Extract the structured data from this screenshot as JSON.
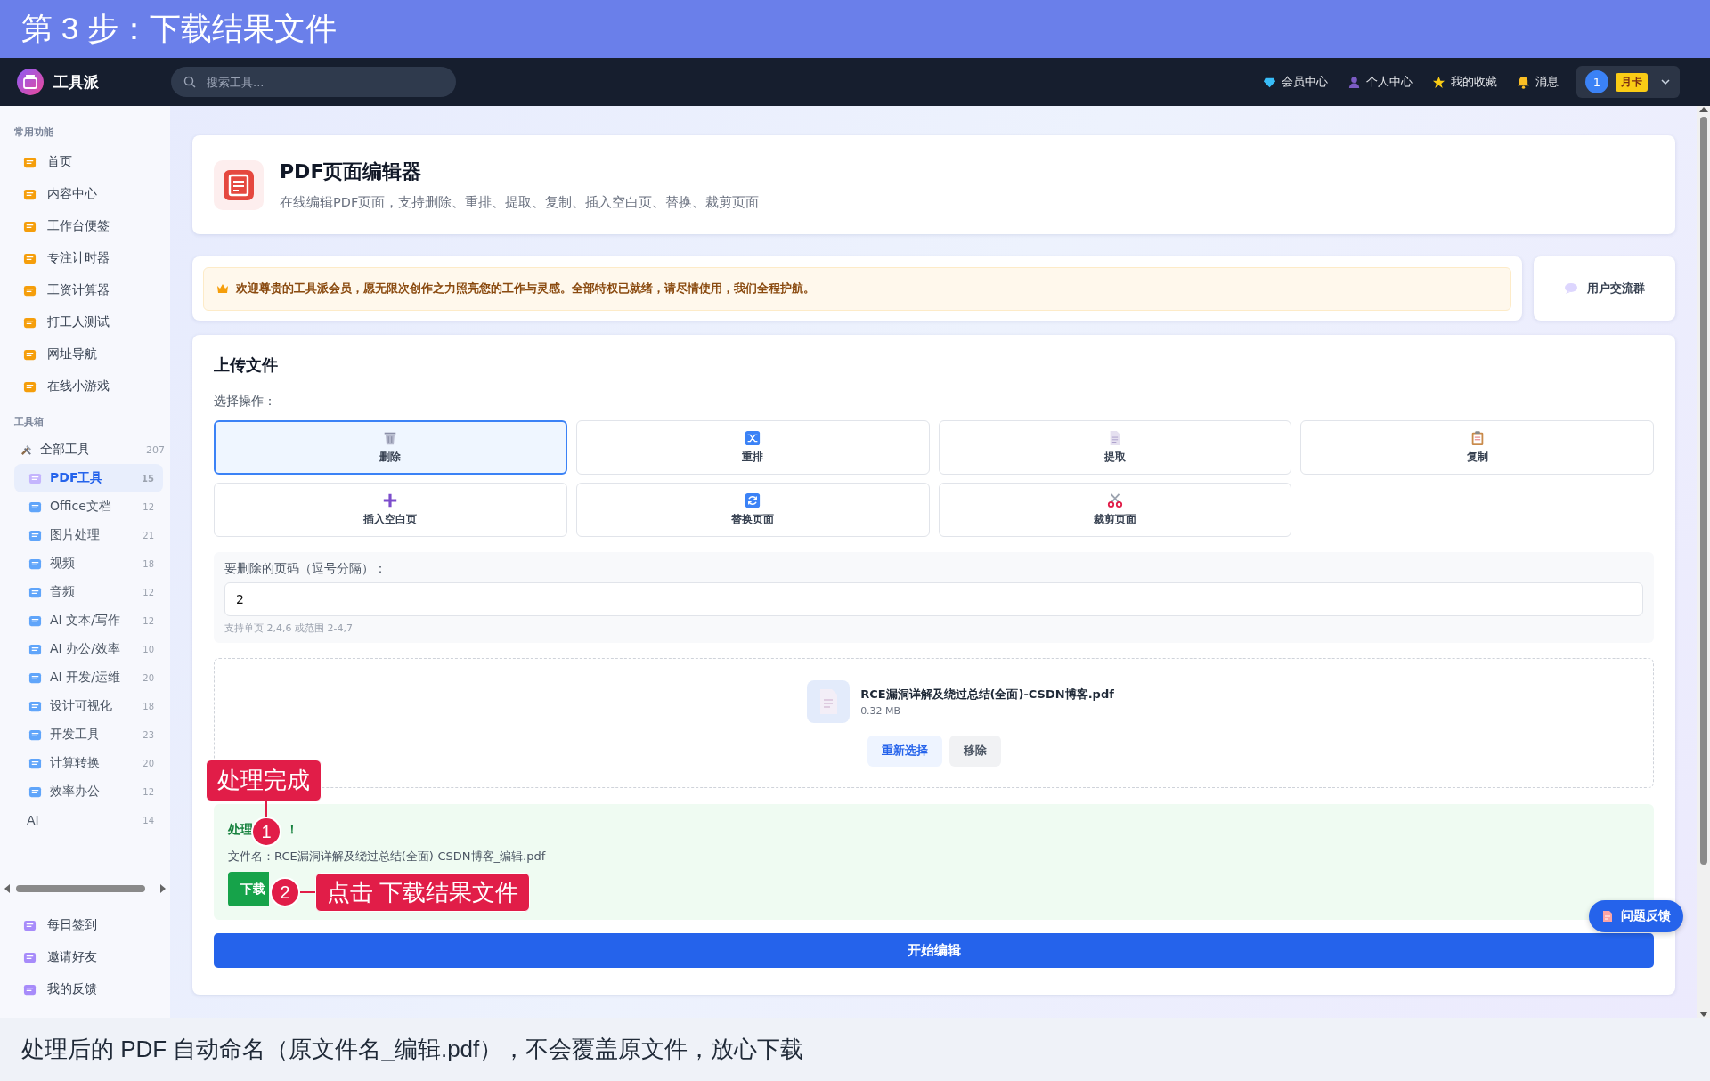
{
  "banner": {
    "title": "第 3 步：下载结果文件"
  },
  "nav": {
    "logo": "工具派",
    "search_placeholder": "搜索工具...",
    "links": [
      {
        "label": "会员中心",
        "kind": "diamond"
      },
      {
        "label": "个人中心",
        "kind": "person"
      },
      {
        "label": "我的收藏",
        "kind": "star"
      },
      {
        "label": "消息",
        "kind": "bell"
      }
    ],
    "user": {
      "avatar": "1",
      "badge": "月卡"
    }
  },
  "sidebar": {
    "sections": [
      {
        "title": "常用功能",
        "items": [
          {
            "label": "首页"
          },
          {
            "label": "内容中心"
          },
          {
            "label": "工作台便签"
          },
          {
            "label": "专注计时器"
          },
          {
            "label": "工资计算器"
          },
          {
            "label": "打工人测试"
          },
          {
            "label": "网址导航"
          },
          {
            "label": "在线小游戏"
          }
        ]
      },
      {
        "title": "工具箱",
        "items": [
          {
            "label": "全部工具",
            "count": "207",
            "selected": false,
            "children": [
              {
                "label": "PDF工具",
                "count": "15",
                "selected": true,
                "kind": "icon"
              },
              {
                "label": "Office文档",
                "count": "12",
                "selected": false,
                "kind": "icon"
              },
              {
                "label": "图片处理",
                "count": "21",
                "selected": false,
                "kind": "icon"
              },
              {
                "label": "视频",
                "count": "18",
                "selected": false,
                "kind": "icon"
              },
              {
                "label": "音频",
                "count": "12",
                "selected": false,
                "kind": "icon"
              },
              {
                "label": "AI 文本/写作",
                "count": "12",
                "selected": false,
                "kind": "icon"
              },
              {
                "label": "AI 办公/效率",
                "count": "10",
                "selected": false,
                "kind": "icon"
              },
              {
                "label": "AI 开发/运维",
                "count": "20",
                "selected": false,
                "kind": "icon"
              },
              {
                "label": "设计可视化",
                "count": "18",
                "selected": false,
                "kind": "icon"
              },
              {
                "label": "开发工具",
                "count": "23",
                "selected": false,
                "kind": "icon"
              },
              {
                "label": "计算转换",
                "count": "20",
                "selected": false,
                "kind": "icon"
              },
              {
                "label": "效率办公",
                "count": "12",
                "selected": false,
                "kind": "icon"
              },
              {
                "label": "AI",
                "count": "14",
                "selected": false,
                "kind": "plain"
              }
            ]
          }
        ]
      }
    ],
    "footer_items": [
      {
        "label": "每日签到"
      },
      {
        "label": "邀请好友"
      },
      {
        "label": "我的反馈"
      }
    ]
  },
  "header": {
    "title": "PDF页面编辑器",
    "subtitle": "在线编辑PDF页面，支持删除、重排、提取、复制、插入空白页、替换、裁剪页面"
  },
  "notice": {
    "text": "欢迎尊贵的工具派会员，愿无限次创作之力照亮您的工作与灵感。全部特权已就绪，请尽情使用，我们全程护航。",
    "group_button": "用户交流群"
  },
  "upload": {
    "title": "上传文件",
    "operation_label": "选择操作：",
    "operations": [
      {
        "label": "删除",
        "kind": "trash",
        "selected": true
      },
      {
        "label": "重排",
        "kind": "shuffle",
        "selected": false
      },
      {
        "label": "提取",
        "kind": "page",
        "selected": false
      },
      {
        "label": "复制",
        "kind": "clipboard",
        "selected": false
      },
      {
        "label": "插入空白页",
        "kind": "plus",
        "selected": false
      },
      {
        "label": "替换页面",
        "kind": "refresh",
        "selected": false
      },
      {
        "label": "裁剪页面",
        "kind": "scissors",
        "selected": false
      }
    ],
    "field": {
      "label": "要删除的页码（逗号分隔）：",
      "value": "2",
      "hint": "支持单页 2,4,6 或范围 2-4,7"
    },
    "file": {
      "name": "RCE漏洞详解及绕过总结(全面)-CSDN博客.pdf",
      "size": "0.32 MB",
      "buttons": [
        "重新选择",
        "移除"
      ]
    },
    "result": {
      "title_parts": [
        "处理",
        "！"
      ],
      "filename": "文件名：RCE漏洞详解及绕过总结(全面)-CSDN博客_编辑.pdf",
      "download_button": "下载"
    },
    "start_button": "开始编辑"
  },
  "feedback_button": "问题反馈",
  "annotations": [
    {
      "number": "1",
      "text": "处理完成"
    },
    {
      "number": "2",
      "text": "点击 下载结果文件"
    }
  ],
  "caption": "处理后的 PDF 自动命名（原文件名_编辑.pdf），不会覆盖原文件，放心下载"
}
